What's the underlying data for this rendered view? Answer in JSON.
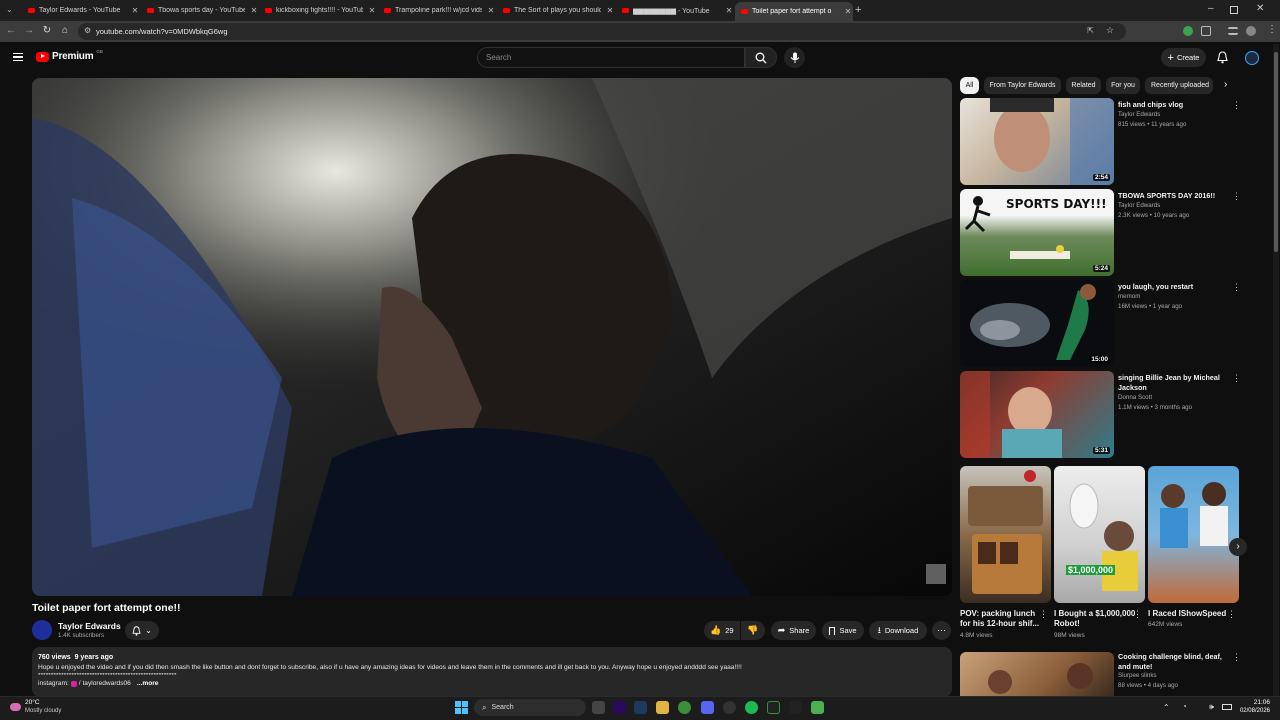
{
  "browser": {
    "tabs": [
      {
        "label": "Taylor Edwards - YouTube",
        "active": false
      },
      {
        "label": "Tbowa sports day - YouTube",
        "active": false
      },
      {
        "label": "kickboxing fights!!!! - YouTube",
        "active": false
      },
      {
        "label": "Trampoline park!!! w/jcd vids",
        "active": false
      },
      {
        "label": "The Sort of plays you should b",
        "active": false
      },
      {
        "label": "▆▆▆▆▆▆▆▆ - YouTube",
        "active": false
      },
      {
        "label": "Toilet paper fort attempt o",
        "active": true
      }
    ],
    "new_tab": "+",
    "url": "youtube.com/watch?v=0MDWbkqG6wg"
  },
  "header": {
    "logo_text": "Premium",
    "logo_badge": "GB",
    "search_placeholder": "Search",
    "create_label": "Create",
    "colors": {
      "brand": "#ff0000",
      "bg": "#0f0f0f",
      "accent": "#3ea6ff"
    }
  },
  "video": {
    "title": "Toilet paper fort attempt one!!",
    "channel": "Taylor Edwards",
    "subscribers": "1.4K subscribers",
    "likes": "29",
    "share_label": "Share",
    "save_label": "Save",
    "download_label": "Download",
    "views": "760 views",
    "age": "9 years ago",
    "description": "Hope u enjoyed the video and if you did then smash the like button and dont forget to subscribe, also if u have any amazing ideas for videos and leave them in the comments and ill get back to you. Anyway hope u enjoyed andddd see yaaa!!!!",
    "description_line2": "******************************************************",
    "instagram_prefix": "instagram: ",
    "instagram_handle": "/ tayloredwards06",
    "more_label": "...more"
  },
  "sidebar": {
    "chips": [
      "All",
      "From Taylor Edwards",
      "Related",
      "For you",
      "Recently uploaded"
    ],
    "videos": [
      {
        "title": "fish and chips vlog",
        "channel": "Taylor Edwards",
        "meta": "815 views • 11 years ago",
        "duration": "2:54"
      },
      {
        "title": "TBOWA SPORTS DAY 2016!!",
        "channel": "Taylor Edwards",
        "meta": "2.3K views • 10 years ago",
        "duration": "5:24",
        "thumb_text": "SPORTS DAY!!!"
      },
      {
        "title": "you laugh, you restart",
        "channel": "memom",
        "meta": "16M views • 1 year ago",
        "duration": "15:00"
      },
      {
        "title": "singing Billie Jean by Micheal Jackson",
        "channel": "Donna Scott",
        "meta": "1.1M views • 3 months ago",
        "duration": "5:31"
      }
    ],
    "shorts": [
      {
        "title": "POV: packing lunch for his 12-hour shif...",
        "views": "4.8M views"
      },
      {
        "title": "I Bought a $1,000,000 Robot!",
        "views": "98M views",
        "thumb_text": "$1,000,000"
      },
      {
        "title": "I Raced IShowSpeed",
        "views": "642M views"
      }
    ],
    "last_video": {
      "title": "Cooking challenge blind, deaf, and mute!",
      "channel": "Slurpee slinks",
      "meta": "88 views • 4 days ago"
    }
  },
  "taskbar": {
    "weather_temp": "20°C",
    "weather_desc": "Mostly cloudy",
    "search_label": "Search",
    "time": "21:06",
    "date": "02/08/2026"
  }
}
